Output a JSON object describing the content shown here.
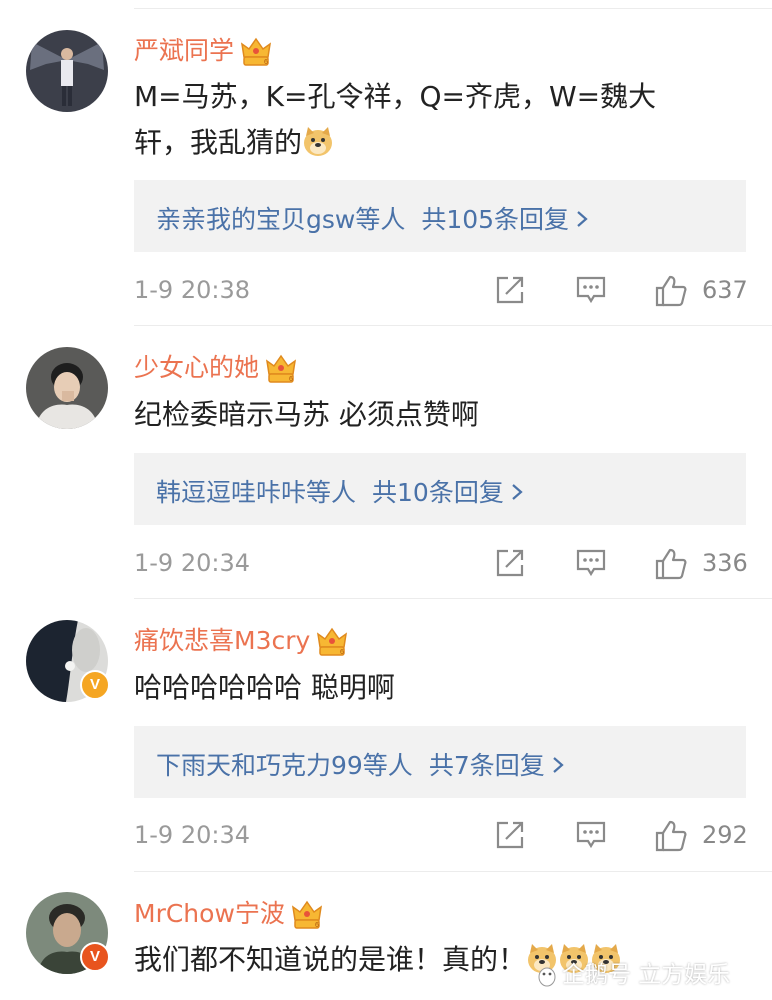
{
  "comments": [
    {
      "username": "严斌同学",
      "text_pre": "M=马苏，K=孔令祥，Q=齐虎，W=魏大",
      "text_line2": "轩，我乱猜的",
      "reply_users": "亲亲我的宝贝gsw等人",
      "reply_count": "共105条回复",
      "time": "1-9 20:38",
      "likes": "637"
    },
    {
      "username": "少女心的她",
      "text_pre": "纪检委暗示马苏 必须点赞啊",
      "reply_users": "韩逗逗哇咔咔等人",
      "reply_count": "共10条回复",
      "time": "1-9 20:34",
      "likes": "336"
    },
    {
      "username": "痛饮悲喜M3cry",
      "text_pre": "哈哈哈哈哈哈 聪明啊",
      "reply_users": "下雨天和巧克力99等人",
      "reply_count": "共7条回复",
      "time": "1-9 20:34",
      "likes": "292"
    },
    {
      "username": "MrChow宁波",
      "text_pre": "我们都不知道说的是谁！真的！"
    }
  ],
  "verified_badge": "V",
  "watermark": "企鹅号 立方娱乐",
  "icons": {
    "vip": "crown-vip-icon",
    "share": "share-icon",
    "comment": "comment-icon",
    "like": "thumbs-up-icon",
    "emoji": "doge-emoji-icon"
  },
  "colors": {
    "username": "#eb7350",
    "reply_link": "#4a72a8",
    "reply_bg": "#f2f2f2",
    "badge": "#f5a623"
  }
}
